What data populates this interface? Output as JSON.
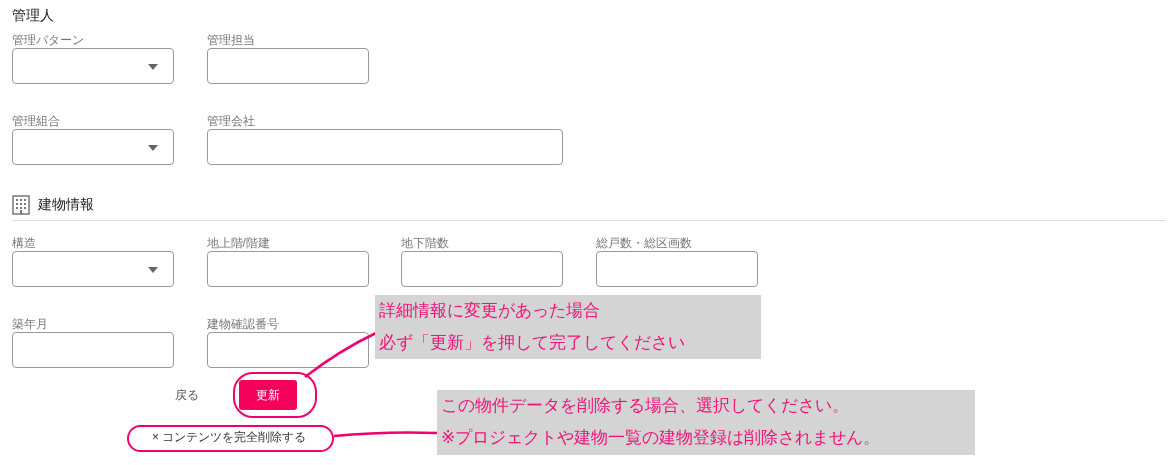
{
  "sections": [
    {
      "title": "管理人",
      "kind": "plain",
      "rows": [
        [
          {
            "label": "管理パターン",
            "kind": "select"
          },
          {
            "label": "管理担当",
            "kind": "text"
          }
        ],
        [
          {
            "label": "管理組合",
            "kind": "select"
          },
          {
            "label": "管理会社",
            "kind": "wide-text"
          }
        ]
      ]
    },
    {
      "title": "建物情報",
      "kind": "with-icon",
      "rows": [
        [
          {
            "label": "構造",
            "kind": "select"
          },
          {
            "label": "地上階/階建",
            "kind": "text"
          },
          {
            "label": "地下階数",
            "kind": "text"
          },
          {
            "label": "総戸数・総区画数",
            "kind": "text"
          }
        ],
        [
          {
            "label": "築年月",
            "kind": "text"
          },
          {
            "label": "建物確認番号",
            "kind": "text"
          }
        ]
      ]
    }
  ],
  "actions": {
    "back": "戻る",
    "update": "更新",
    "delete": "× コンテンツを完全削除する"
  },
  "annotations": [
    {
      "lines": [
        "詳細情報に変更があった場合",
        "必ず「更新」を押して完了してください"
      ]
    },
    {
      "lines": [
        "この物件データを削除する場合、選択してください。",
        "※プロジェクトや建物一覧の建物登録は削除されません。"
      ]
    }
  ]
}
